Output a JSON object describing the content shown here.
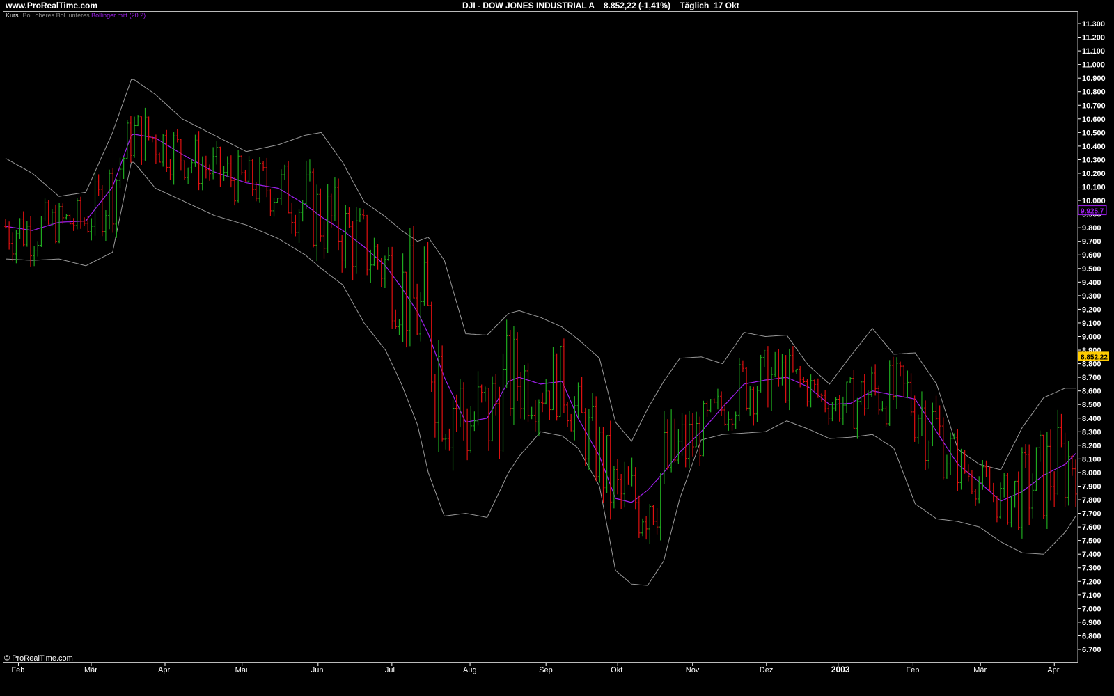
{
  "header": {
    "site": "www.ProRealTime.com",
    "title": "DJI - DOW JONES INDUSTRIAL A    8.852,22 (-1,41%)    Täglich  17 Okt"
  },
  "legend": {
    "price": "Kurs",
    "upper": "Bol. oberes",
    "lower": "Bol. unteres",
    "mid": "Bollinger mitt (20 2)"
  },
  "copyright": "© ProRealTime.com",
  "colors": {
    "background": "#000000",
    "up_bar": "#1faa1f",
    "down_bar": "#e01010",
    "bands": "#9a9a9a",
    "mid": "#a020f0",
    "price_tag": "#ffcc00"
  },
  "chart_data": {
    "type": "ohlc",
    "indicator": "Bollinger bands (20, 2)",
    "ylim": [
      6700,
      11300
    ],
    "y_ticks": [
      "11.300",
      "11.200",
      "11.100",
      "11.000",
      "10.900",
      "10.800",
      "10.700",
      "10.600",
      "10.500",
      "10.400",
      "10.300",
      "10.200",
      "10.100",
      "10.000",
      "9.900",
      "9.800",
      "9.700",
      "9.600",
      "9.500",
      "9.400",
      "9.300",
      "9.200",
      "9.100",
      "9.000",
      "8.900",
      "8.800",
      "8.700",
      "8.600",
      "8.500",
      "8.400",
      "8.300",
      "8.200",
      "8.100",
      "8.000",
      "7.900",
      "7.800",
      "7.700",
      "7.600",
      "7.500",
      "7.400",
      "7.300",
      "7.200",
      "7.100",
      "7.000",
      "6.900",
      "6.800",
      "6.700"
    ],
    "x_ticks": [
      "Feb",
      "Mär",
      "Apr",
      "Mai",
      "Jun",
      "Jul",
      "Aug",
      "Sep",
      "Okt",
      "Nov",
      "Dez",
      "2003",
      "Feb",
      "Mär",
      "Apr"
    ],
    "last_price_label": "8.852,22",
    "last_price": 8852.22,
    "mid_tag_label": "9.925,7",
    "mid_tag_value": 9925.7,
    "bands": [
      [
        0.0,
        10310,
        9810,
        9570
      ],
      [
        0.025,
        10200,
        9780,
        9560
      ],
      [
        0.05,
        10030,
        9840,
        9570
      ],
      [
        0.075,
        10060,
        9850,
        9520
      ],
      [
        0.1,
        10500,
        10100,
        9620
      ],
      [
        0.118,
        10900,
        10490,
        10300
      ],
      [
        0.14,
        10780,
        10460,
        10090
      ],
      [
        0.165,
        10600,
        10340,
        10000
      ],
      [
        0.195,
        10480,
        10210,
        9890
      ],
      [
        0.225,
        10360,
        10130,
        9820
      ],
      [
        0.255,
        10410,
        10090,
        9720
      ],
      [
        0.28,
        10480,
        9970,
        9600
      ],
      [
        0.295,
        10500,
        9880,
        9500
      ],
      [
        0.315,
        10280,
        9780,
        9380
      ],
      [
        0.335,
        9990,
        9660,
        9100
      ],
      [
        0.355,
        9880,
        9520,
        8900
      ],
      [
        0.37,
        9780,
        9360,
        8650
      ],
      [
        0.385,
        9700,
        9180,
        8350
      ],
      [
        0.395,
        9730,
        9020,
        8000
      ],
      [
        0.41,
        9560,
        8700,
        7680
      ],
      [
        0.43,
        9020,
        8370,
        7700
      ],
      [
        0.45,
        9010,
        8400,
        7670
      ],
      [
        0.47,
        9170,
        8670,
        8000
      ],
      [
        0.48,
        9190,
        8700,
        8120
      ],
      [
        0.5,
        9140,
        8650,
        8300
      ],
      [
        0.52,
        9070,
        8670,
        8270
      ],
      [
        0.535,
        8980,
        8400,
        8180
      ],
      [
        0.555,
        8840,
        8120,
        7900
      ],
      [
        0.57,
        8370,
        7810,
        7280
      ],
      [
        0.585,
        8230,
        7780,
        7180
      ],
      [
        0.6,
        8470,
        7870,
        7170
      ],
      [
        0.615,
        8670,
        8000,
        7350
      ],
      [
        0.63,
        8840,
        8150,
        7810
      ],
      [
        0.65,
        8850,
        8300,
        8240
      ],
      [
        0.67,
        8800,
        8480,
        8280
      ],
      [
        0.69,
        9030,
        8650,
        8290
      ],
      [
        0.71,
        9000,
        8680,
        8300
      ],
      [
        0.73,
        9010,
        8700,
        8380
      ],
      [
        0.75,
        8790,
        8630,
        8320
      ],
      [
        0.77,
        8650,
        8500,
        8250
      ],
      [
        0.79,
        8860,
        8510,
        8260
      ],
      [
        0.81,
        9060,
        8600,
        8280
      ],
      [
        0.83,
        8870,
        8570,
        8180
      ],
      [
        0.85,
        8880,
        8540,
        7770
      ],
      [
        0.87,
        8650,
        8300,
        7660
      ],
      [
        0.89,
        8170,
        8060,
        7640
      ],
      [
        0.91,
        8060,
        7930,
        7600
      ],
      [
        0.93,
        8020,
        7790,
        7490
      ],
      [
        0.95,
        8330,
        7860,
        7410
      ],
      [
        0.97,
        8550,
        7980,
        7400
      ],
      [
        0.99,
        8620,
        8060,
        7560
      ],
      [
        1.0,
        8620,
        8140,
        7680
      ]
    ]
  }
}
